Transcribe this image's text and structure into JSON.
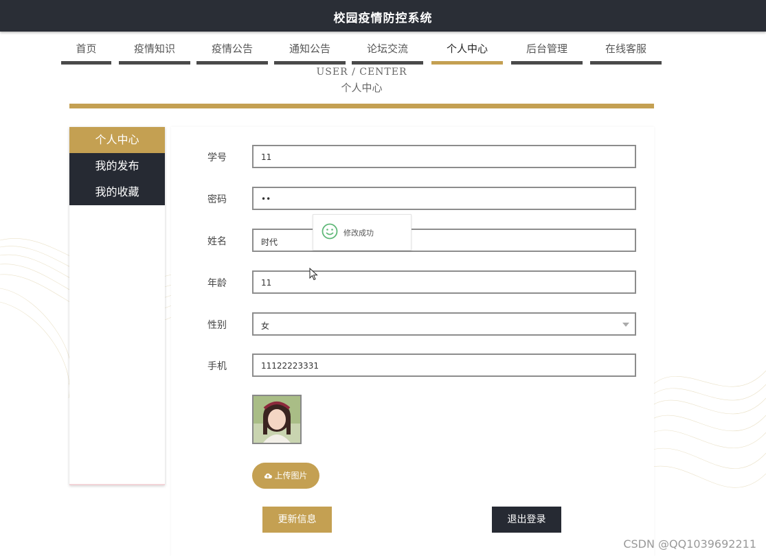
{
  "header": {
    "title": "校园疫情防控系统"
  },
  "nav": {
    "items": [
      {
        "label": "首页"
      },
      {
        "label": "疫情知识"
      },
      {
        "label": "疫情公告"
      },
      {
        "label": "通知公告"
      },
      {
        "label": "论坛交流"
      },
      {
        "label": "个人中心",
        "active": true
      },
      {
        "label": "后台管理"
      },
      {
        "label": "在线客服"
      }
    ]
  },
  "page_head": {
    "en": "USER / CENTER",
    "cn": "个人中心"
  },
  "sidebar": {
    "items": [
      {
        "label": "个人中心",
        "active": true
      },
      {
        "label": "我的发布"
      },
      {
        "label": "我的收藏"
      }
    ]
  },
  "form": {
    "fields": [
      {
        "label": "学号",
        "value": "11"
      },
      {
        "label": "密码",
        "value": "••"
      },
      {
        "label": "姓名",
        "value": "时代"
      },
      {
        "label": "年龄",
        "value": "11"
      },
      {
        "label": "性别",
        "value": "女"
      },
      {
        "label": "手机",
        "value": "11122223331"
      }
    ],
    "upload_label": "上传图片",
    "update_label": "更新信息",
    "logout_label": "退出登录"
  },
  "toast": {
    "message": "修改成功"
  },
  "watermark": "CSDN @QQ1039692211",
  "colors": {
    "accent": "#c4a052",
    "dark": "#262a33",
    "topbar": "#2a2e36"
  }
}
